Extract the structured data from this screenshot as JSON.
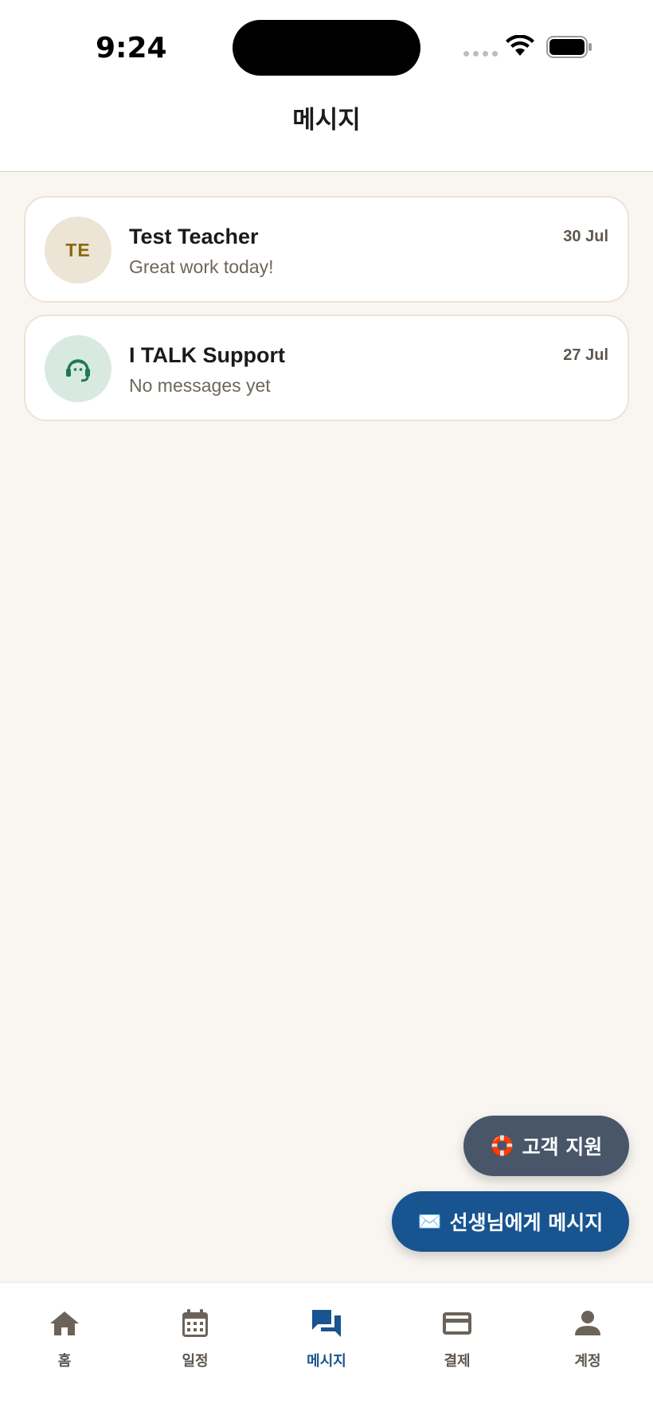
{
  "status_bar": {
    "time": "9:24"
  },
  "header": {
    "title": "메시지"
  },
  "conversations": [
    {
      "avatar_text": "TE",
      "name": "Test Teacher",
      "preview": "Great work today!",
      "date": "30 Jul",
      "avatar_icon": "initials"
    },
    {
      "avatar_text": "",
      "name": "I TALK Support",
      "preview": "No messages yet",
      "date": "27 Jul",
      "avatar_icon": "headset-icon"
    }
  ],
  "actions": {
    "support_emoji": "🛟",
    "support_label": "고객 지원",
    "message_emoji": "✉️",
    "message_label": "선생님에게 메시지"
  },
  "tabs": [
    {
      "label": "홈",
      "icon": "home-icon",
      "active": false
    },
    {
      "label": "일정",
      "icon": "calendar-icon",
      "active": false
    },
    {
      "label": "메시지",
      "icon": "chat-icon",
      "active": true
    },
    {
      "label": "결제",
      "icon": "credit-card-icon",
      "active": false
    },
    {
      "label": "계정",
      "icon": "person-icon",
      "active": false
    }
  ],
  "colors": {
    "background": "#f9f6f1",
    "accent": "#18548f",
    "support_button": "#495669",
    "tab_inactive": "#5e574e",
    "support_icon": "#1f7a4f"
  }
}
